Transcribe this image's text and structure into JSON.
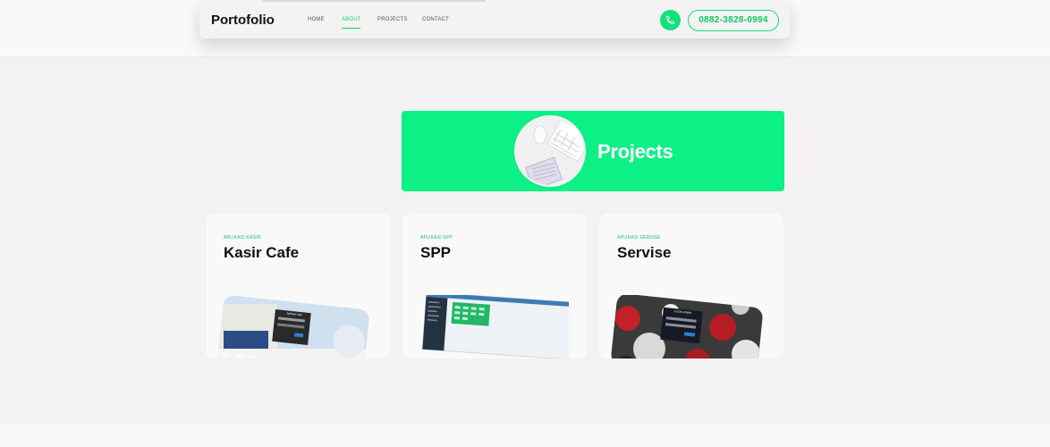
{
  "nav": {
    "brand": "Portofolio",
    "links": [
      "HOME",
      "ABOUT",
      "PROJECTS",
      "CONTACT"
    ],
    "active": "ABOUT",
    "phone": "0882-3828-0994"
  },
  "banner": {
    "title": "Projects"
  },
  "cards": [
    {
      "tag": "APLIKASI KASIR",
      "title": "Kasir Cafe",
      "screenshot_caption": "Aplikasi Cafe"
    },
    {
      "tag": "APLIKASI SPP",
      "title": "SPP"
    },
    {
      "tag": "APLIKASI SERVISE",
      "title": "Servise",
      "screenshot_caption": "LOGIN ADMIN"
    }
  ],
  "colors": {
    "accent": "#0cf085",
    "accent_text": "#10c765",
    "page_bg": "#f3f1f2"
  }
}
